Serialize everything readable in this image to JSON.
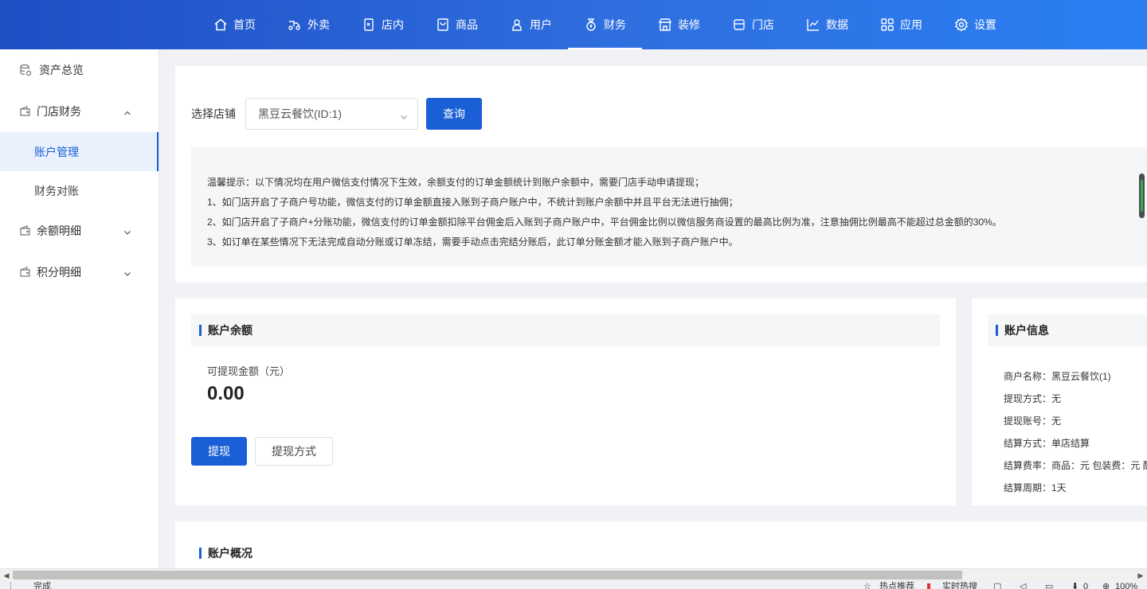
{
  "topnav": {
    "items": [
      {
        "label": "首页",
        "icon": "home-icon"
      },
      {
        "label": "外卖",
        "icon": "delivery-icon"
      },
      {
        "label": "店内",
        "icon": "dine-in-icon"
      },
      {
        "label": "商品",
        "icon": "goods-icon"
      },
      {
        "label": "用户",
        "icon": "user-icon"
      },
      {
        "label": "财务",
        "icon": "finance-icon",
        "active": true
      },
      {
        "label": "装修",
        "icon": "decoration-icon"
      },
      {
        "label": "门店",
        "icon": "store-icon"
      },
      {
        "label": "数据",
        "icon": "chart-icon"
      },
      {
        "label": "应用",
        "icon": "apps-icon"
      },
      {
        "label": "设置",
        "icon": "gear-icon"
      }
    ]
  },
  "sidebar": {
    "asset_overview": "资产总览",
    "store_finance": "门店财务",
    "account_management": "账户管理",
    "reconciliation": "财务对账",
    "balance_detail": "余额明细",
    "points_detail": "积分明细"
  },
  "filter": {
    "label": "选择店铺",
    "store_value": "黑豆云餐饮(ID:1)",
    "query_button": "查询"
  },
  "notice": {
    "lines": [
      "温馨提示：以下情况均在用户微信支付情况下生效，余额支付的订单金额统计到账户余额中，需要门店手动申请提现；",
      "1、如门店开启了子商户号功能，微信支付的订单金额直接入账到子商户账户中，不统计到账户余额中并且平台无法进行抽佣；",
      "2、如门店开启了子商户+分账功能，微信支付的订单金额扣除平台佣金后入账到子商户账户中，平台佣金比例以微信服务商设置的最高比例为准，注意抽佣比例最高不能超过总金额的30%。",
      "3、如订单在某些情况下无法完成自动分账或订单冻结，需要手动点击完结分账后，此订单分账金额才能入账到子商户账户中。"
    ]
  },
  "balance": {
    "title": "账户余额",
    "withdrawable_label": "可提现金额（元）",
    "withdrawable_value": "0.00",
    "withdraw_button": "提现",
    "withdraw_method_button": "提现方式"
  },
  "account_info": {
    "title": "账户信息",
    "lines": [
      "商户名称：黑豆云餐饮(1)",
      "提现方式：无",
      "提现账号：无",
      "结算方式：单店结算",
      "结算费率：商品：元 包装费：元 配",
      "结算周期：1天"
    ]
  },
  "overview": {
    "title": "账户概况"
  },
  "statusbar": {
    "left": "完成",
    "hot": "热点推荐",
    "realtime": "实时热搜",
    "download_count": "0",
    "zoom": "100%"
  },
  "colors": {
    "primary": "#1a5fd6",
    "nav_gradient_start": "#1e4fc4",
    "nav_gradient_end": "#2a7ff2"
  }
}
